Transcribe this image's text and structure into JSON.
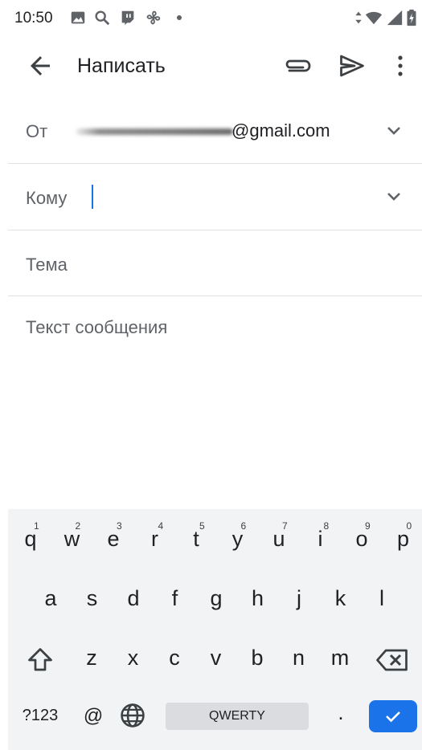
{
  "status_bar": {
    "time": "10:50",
    "icons": [
      "image-icon",
      "search-icon",
      "twitch-icon",
      "fan-icon",
      "dot-icon",
      "data-arrows-icon",
      "wifi-icon",
      "signal-icon",
      "battery-icon"
    ]
  },
  "app_bar": {
    "title": "Написать",
    "icons": [
      "back-arrow-icon",
      "paperclip-icon",
      "send-icon",
      "more-vert-icon"
    ]
  },
  "compose": {
    "from_label": "От",
    "from_email_visible": "@gmail.com",
    "to_label": "Кому",
    "to_value": "",
    "subject_placeholder": "Тема",
    "body_placeholder": "Текст сообщения"
  },
  "keyboard": {
    "row1": [
      {
        "key": "q",
        "hint": "1"
      },
      {
        "key": "w",
        "hint": "2"
      },
      {
        "key": "e",
        "hint": "3"
      },
      {
        "key": "r",
        "hint": "4"
      },
      {
        "key": "t",
        "hint": "5"
      },
      {
        "key": "y",
        "hint": "6"
      },
      {
        "key": "u",
        "hint": "7"
      },
      {
        "key": "i",
        "hint": "8"
      },
      {
        "key": "o",
        "hint": "9"
      },
      {
        "key": "p",
        "hint": "0"
      }
    ],
    "row2": [
      "a",
      "s",
      "d",
      "f",
      "g",
      "h",
      "j",
      "k",
      "l"
    ],
    "row3": [
      "z",
      "x",
      "c",
      "v",
      "b",
      "n",
      "m"
    ],
    "symbols_label": "?123",
    "at_label": "@",
    "space_label": "QWERTY",
    "period_label": ".",
    "accent_color": "#1a73e8"
  }
}
